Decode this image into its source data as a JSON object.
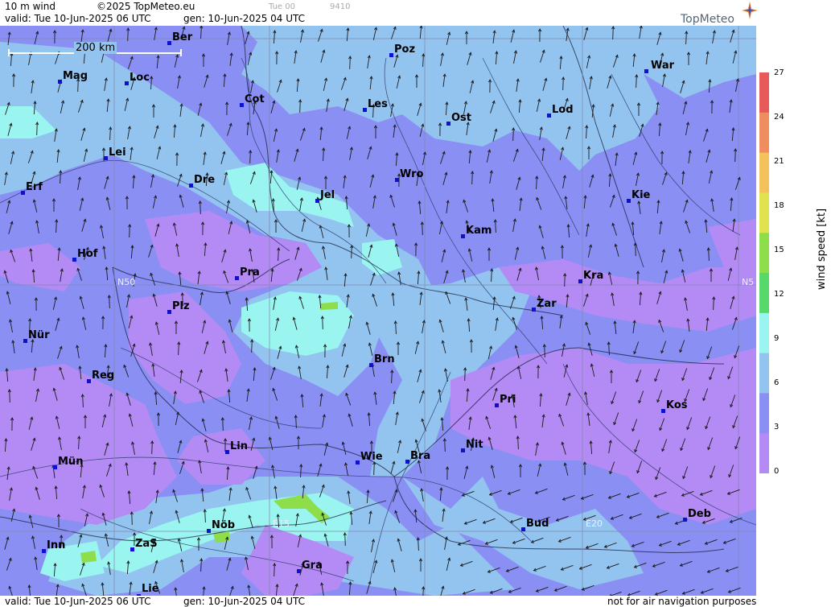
{
  "header": {
    "product": "10 m wind",
    "copyright": "©2025 TopMeteo.eu",
    "valid": "valid:  Tue  10-Jun-2025  06 UTC",
    "gen": "gen: 10-Jun-2025 04 UTC",
    "faint_time": "Tue 00",
    "faint_code": "9410",
    "logo": "TopMeteo"
  },
  "footer": {
    "valid": "valid:  Tue  10-Jun-2025  06 UTC",
    "gen": "gen: 10-Jun-2025 04 UTC",
    "note": "not for air navigation purposes"
  },
  "scale": {
    "label": "200 km"
  },
  "grid_labels": {
    "n50_left": "N50",
    "n50_right": "N5",
    "e15": "E15",
    "e20": "E20"
  },
  "cities": [
    {
      "name": "Ber"
    },
    {
      "name": "Poz"
    },
    {
      "name": "War"
    },
    {
      "name": "Mag"
    },
    {
      "name": "Loc"
    },
    {
      "name": "Cot"
    },
    {
      "name": "Les"
    },
    {
      "name": "Ost"
    },
    {
      "name": "Lod"
    },
    {
      "name": "Lei"
    },
    {
      "name": "Erf"
    },
    {
      "name": "Dre"
    },
    {
      "name": "Jel"
    },
    {
      "name": "Wro"
    },
    {
      "name": "Kie"
    },
    {
      "name": "Kam"
    },
    {
      "name": "Hof"
    },
    {
      "name": "Pra"
    },
    {
      "name": "Kra"
    },
    {
      "name": "Plz"
    },
    {
      "name": "Zar"
    },
    {
      "name": "Nür"
    },
    {
      "name": "Brn"
    },
    {
      "name": "Reg"
    },
    {
      "name": "Pri"
    },
    {
      "name": "Kos"
    },
    {
      "name": "Lin"
    },
    {
      "name": "Nit"
    },
    {
      "name": "Mün"
    },
    {
      "name": "Wie"
    },
    {
      "name": "Bra"
    },
    {
      "name": "Deb"
    },
    {
      "name": "Nöb"
    },
    {
      "name": "Bud"
    },
    {
      "name": "Inn"
    },
    {
      "name": "ZaS"
    },
    {
      "name": "Gra"
    },
    {
      "name": "Lie"
    }
  ],
  "legend": {
    "title": "wind speed [kt]",
    "ticks": [
      "27",
      "24",
      "21",
      "18",
      "15",
      "12",
      "9",
      "6",
      "3",
      "0"
    ],
    "colors": [
      "#e8595a",
      "#ef8d5e",
      "#f3c25a",
      "#dfe44e",
      "#8ede4c",
      "#56d86a",
      "#9af4f0",
      "#93c4f0",
      "#8a8ff4",
      "#b48bf4"
    ]
  },
  "colors": {
    "violet": "#b48bf4",
    "purple_blue": "#8a8ff4",
    "light_blue": "#93c4f0",
    "cyan": "#9af4f0",
    "green": "#8ede4c"
  }
}
